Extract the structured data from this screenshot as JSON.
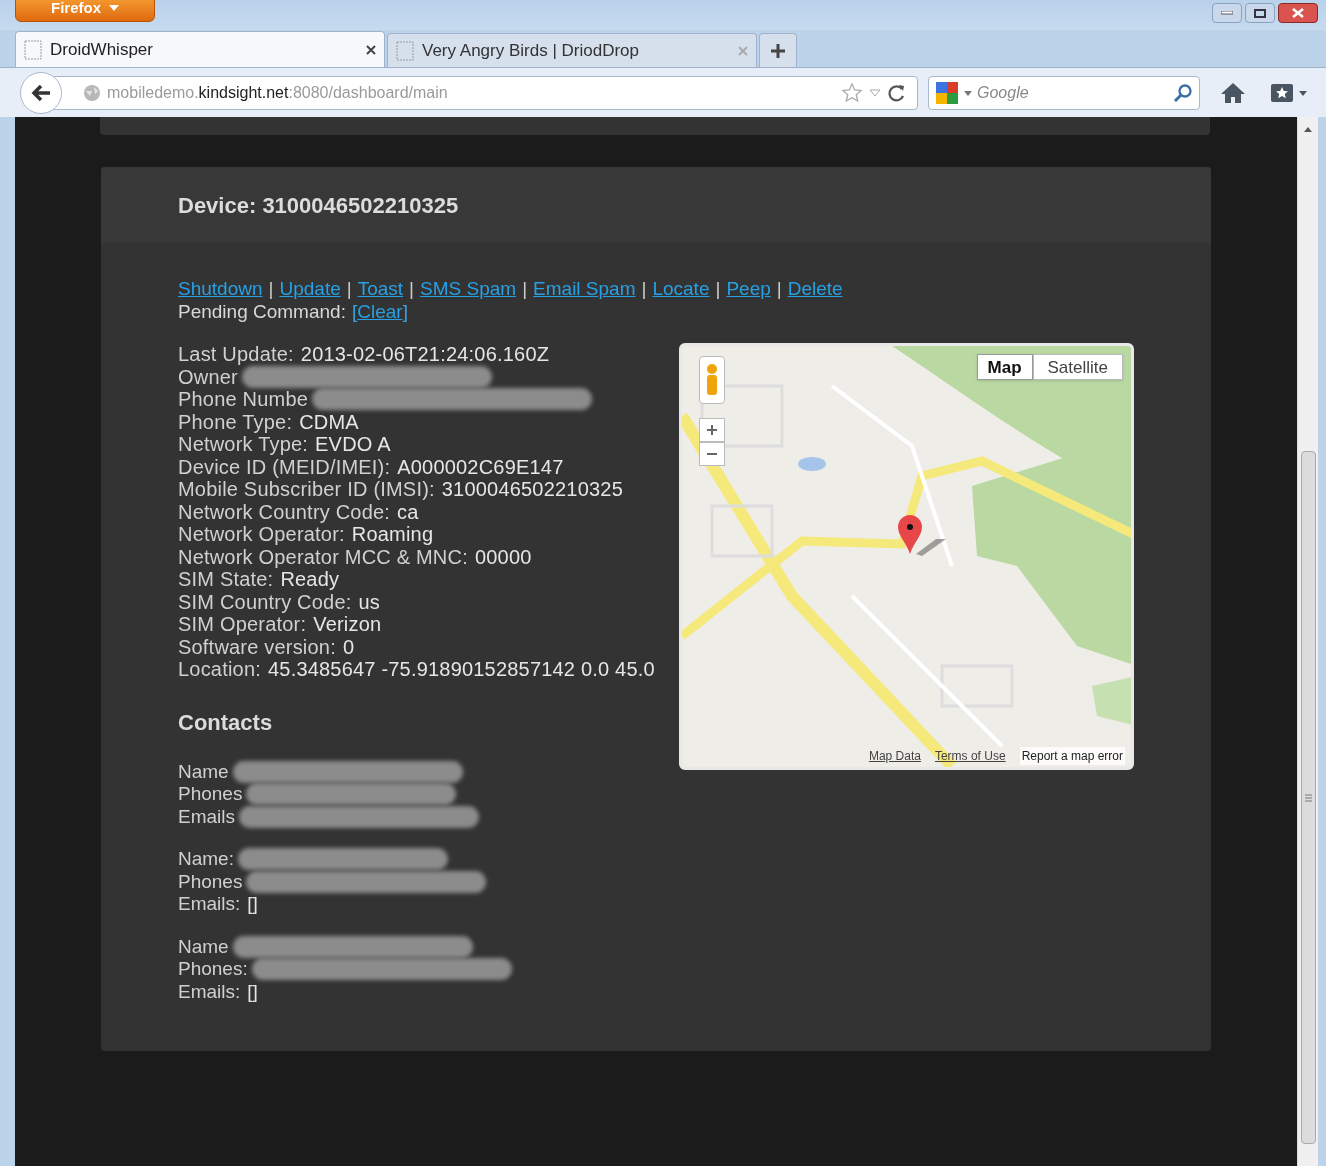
{
  "browser": {
    "menu_button": "Firefox",
    "tabs": [
      {
        "title": "DroidWhisper",
        "selected": true
      },
      {
        "title": "Very Angry Birds | DriodDrop",
        "selected": false
      }
    ],
    "url": {
      "host_prefix": "mobiledemo.",
      "host_main": "kindsight.net",
      "rest": ":8080/dashboard/main"
    },
    "search": {
      "placeholder": "Google"
    }
  },
  "device": {
    "title": "Device: 3100046502210325",
    "commands": [
      "Shutdown",
      "Update",
      "Toast",
      "SMS Spam",
      "Email Spam",
      "Locate",
      "Peep",
      "Delete"
    ],
    "command_separator": "|",
    "pending_label": "Pending Command:",
    "pending_open": "[",
    "pending_link": "Clear",
    "pending_close": "]",
    "info": [
      {
        "label": "Last Update:",
        "value": "2013-02-06T21:24:06.160Z",
        "redacted": false
      },
      {
        "label": "Owner",
        "redacted": true
      },
      {
        "label": "Phone Numbe",
        "redacted": true
      },
      {
        "label": "Phone Type:",
        "value": "CDMA",
        "redacted": false
      },
      {
        "label": "Network Type:",
        "value": "EVDO A",
        "redacted": false
      },
      {
        "label": "Device ID (MEID/IMEI):",
        "value": "A000002C69E147",
        "redacted": false
      },
      {
        "label": "Mobile Subscriber ID (IMSI):",
        "value": "3100046502210325",
        "redacted": false
      },
      {
        "label": "Network Country Code:",
        "value": "ca",
        "redacted": false
      },
      {
        "label": "Network Operator:",
        "value": "Roaming",
        "redacted": false
      },
      {
        "label": "Network Operator MCC & MNC:",
        "value": "00000",
        "redacted": false
      },
      {
        "label": "SIM State:",
        "value": "Ready",
        "redacted": false
      },
      {
        "label": "SIM Country Code:",
        "value": "us",
        "redacted": false
      },
      {
        "label": "SIM Operator:",
        "value": "Verizon",
        "redacted": false
      },
      {
        "label": "Software version:",
        "value": "0",
        "redacted": false
      },
      {
        "label": "Location:",
        "value": "45.3485647 -75.91890152857142 0.0 45.0",
        "redacted": false
      }
    ],
    "contacts_title": "Contacts",
    "contacts": [
      [
        {
          "label": "Name",
          "redacted": true
        },
        {
          "label": "Phones",
          "redacted": true
        },
        {
          "label": "Emails",
          "redacted": true
        }
      ],
      [
        {
          "label": "Name:",
          "redacted": true
        },
        {
          "label": "Phones",
          "redacted": true
        },
        {
          "label": "Emails:",
          "value": "[]",
          "redacted": false
        }
      ],
      [
        {
          "label": "Name",
          "redacted": true
        },
        {
          "label": "Phones:",
          "redacted": true
        },
        {
          "label": "Emails:",
          "value": "[]",
          "redacted": false
        }
      ]
    ],
    "map": {
      "types": [
        {
          "label": "Map",
          "selected": true
        },
        {
          "label": "Satellite",
          "selected": false
        }
      ],
      "footer_links": [
        "Map Data",
        "Terms of Use"
      ],
      "report": "Report a map error"
    }
  }
}
